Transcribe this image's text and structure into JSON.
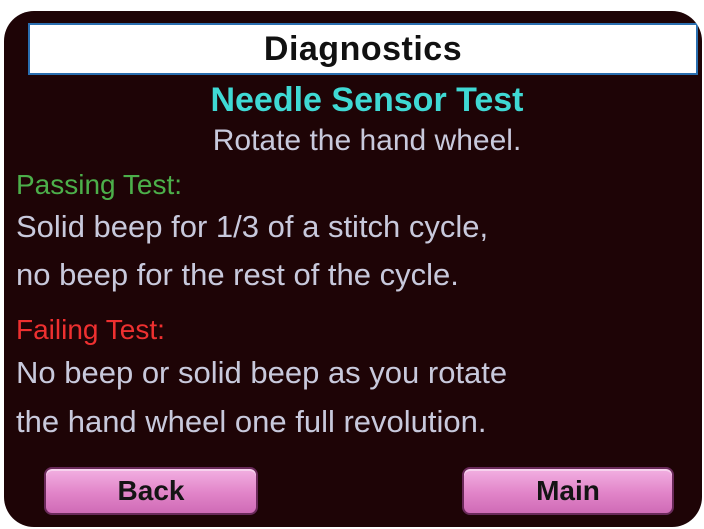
{
  "header": {
    "title": "Diagnostics"
  },
  "test": {
    "name": "Needle Sensor Test",
    "instruction": "Rotate the hand wheel.",
    "passing": {
      "heading": "Passing Test:",
      "lines": [
        "Solid beep for 1/3 of a stitch cycle,",
        "no beep for the rest of the cycle."
      ]
    },
    "failing": {
      "heading": "Failing Test:",
      "lines": [
        "No beep or solid beep as you rotate",
        "the hand wheel one full revolution."
      ]
    }
  },
  "buttons": {
    "back_label": "Back",
    "main_label": "Main"
  },
  "colors": {
    "background": "#1e0406",
    "test_name": "#3fd9d4",
    "passing": "#4caf4a",
    "failing": "#ee3030",
    "body_text": "#c8c9dc",
    "button": "#e184c8"
  }
}
